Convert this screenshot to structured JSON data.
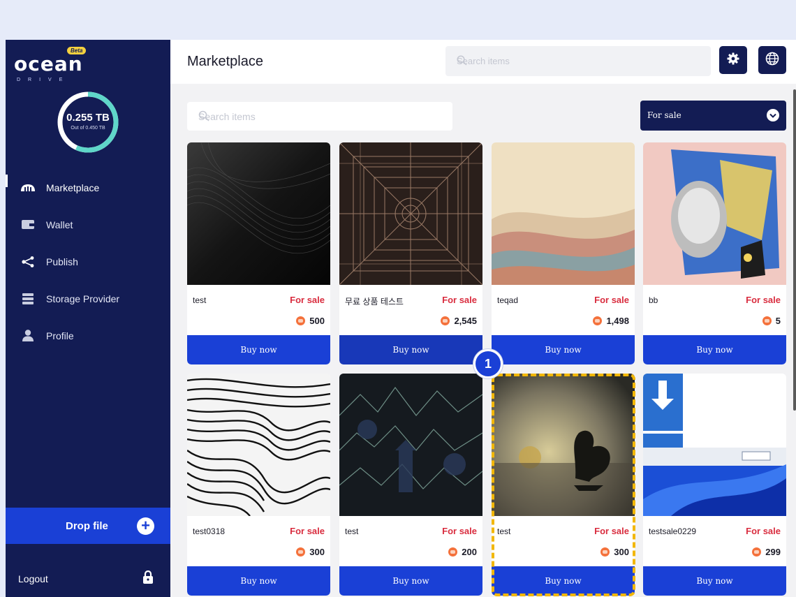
{
  "app": {
    "logo_text": "ocean",
    "logo_sub": "DRIVE",
    "beta_badge": "Beta"
  },
  "storage": {
    "used": "0.255 TB",
    "total_text": "Out of 0.450 TB",
    "fraction_used": 0.567
  },
  "sidebar": {
    "items": [
      {
        "label": "Marketplace",
        "icon": "marketplace-icon",
        "active": true
      },
      {
        "label": "Wallet",
        "icon": "wallet-icon",
        "active": false
      },
      {
        "label": "Publish",
        "icon": "share-icon",
        "active": false
      },
      {
        "label": "Storage Provider",
        "icon": "server-icon",
        "active": false
      },
      {
        "label": "Profile",
        "icon": "user-icon",
        "active": false
      }
    ],
    "drop_label": "Drop file",
    "logout_label": "Logout"
  },
  "header": {
    "title": "Marketplace",
    "search_placeholder": "Search items"
  },
  "content": {
    "search_placeholder": "Search items",
    "filter_value": "For sale"
  },
  "cards": [
    {
      "name": "test",
      "status": "For sale",
      "price": "500",
      "buy": "Buy now"
    },
    {
      "name": "무료 상품 테스트",
      "status": "For sale",
      "price": "2,545",
      "buy": "Buy now"
    },
    {
      "name": "teqad",
      "status": "For sale",
      "price": "1,498",
      "buy": "Buy now"
    },
    {
      "name": "bb",
      "status": "For sale",
      "price": "5",
      "buy": "Buy now"
    },
    {
      "name": "test0318",
      "status": "For sale",
      "price": "300",
      "buy": "Buy now"
    },
    {
      "name": "test",
      "status": "For sale",
      "price": "200",
      "buy": "Buy now"
    },
    {
      "name": "test",
      "status": "For sale",
      "price": "300",
      "buy": "Buy now"
    },
    {
      "name": "testsale0229",
      "status": "For sale",
      "price": "299",
      "buy": "Buy now"
    }
  ],
  "callout": {
    "step": "1"
  },
  "colors": {
    "sidebar": "#131c54",
    "accent": "#1a40d6",
    "sale": "#d92d3f",
    "highlight": "#f2b705"
  }
}
